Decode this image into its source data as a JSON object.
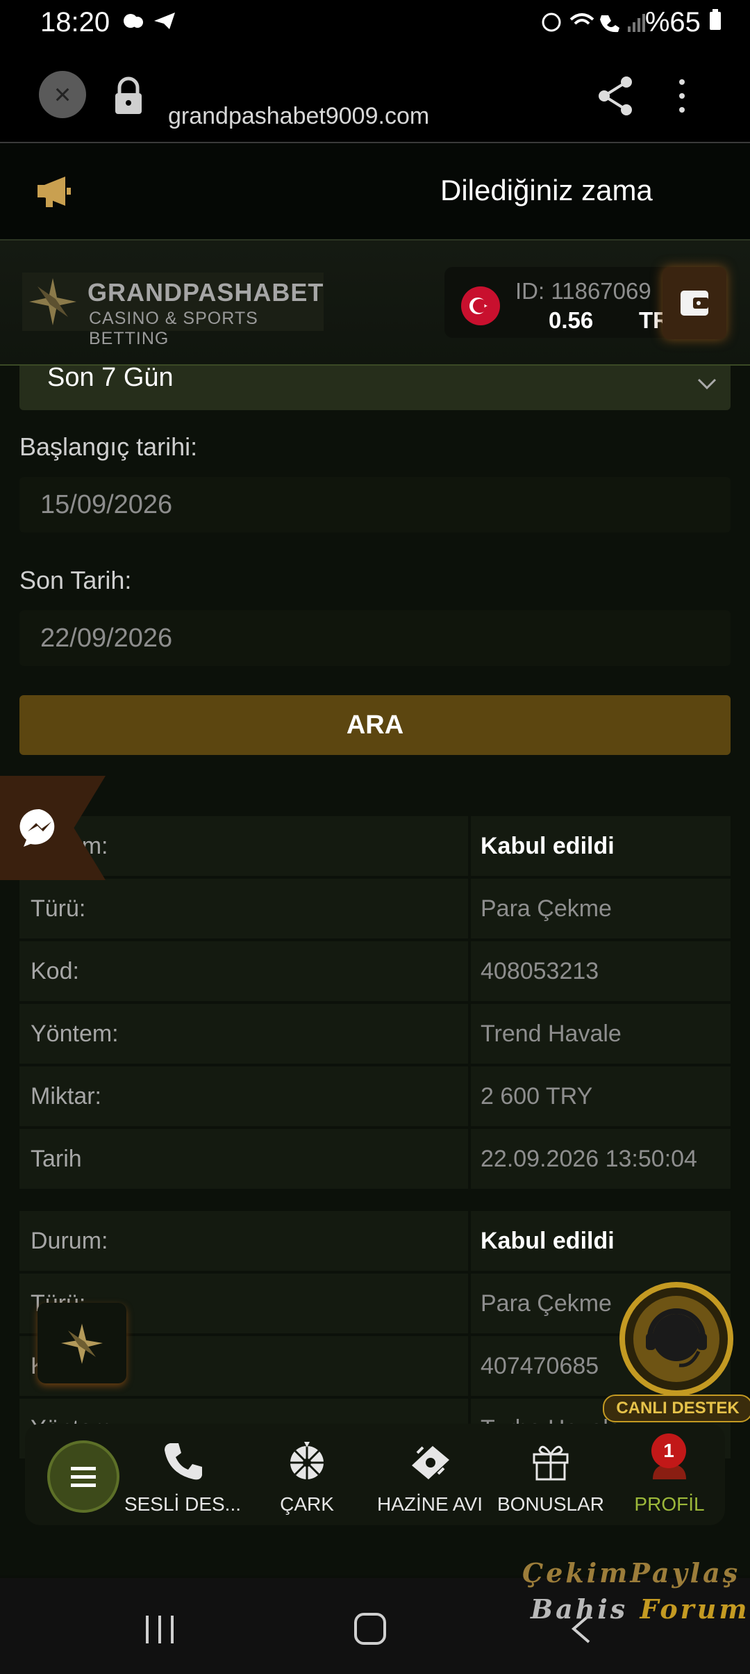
{
  "status_bar": {
    "time": "18:20",
    "battery": "%65",
    "left_icons": "weather telegram",
    "right_icons": "alarm wifi call signal"
  },
  "browser": {
    "url": "grandpashabet9009.com"
  },
  "announcement": {
    "text": "Dilediğiniz zama"
  },
  "header": {
    "logo_title": "GRANDPASHABET",
    "logo_subtitle": "CASINO & SPORTS BETTING",
    "account_id": "ID: 11867069",
    "balance": "0.56",
    "currency": "TRY"
  },
  "filters": {
    "period": "Son 7 Gün",
    "start_label": "Başlangıç tarihi:",
    "start_value": "15/09/2026",
    "end_label": "Son Tarih:",
    "end_value": "22/09/2026",
    "search_button": "ARA"
  },
  "transactions": [
    {
      "rows": [
        {
          "label": "Durum:",
          "value": "Kabul edildi"
        },
        {
          "label": "Türü:",
          "value": "Para Çekme"
        },
        {
          "label": "Kod:",
          "value": "408053213"
        },
        {
          "label": "Yöntem:",
          "value": "Trend Havale"
        },
        {
          "label": "Miktar:",
          "value": "2 600 TRY"
        },
        {
          "label": "Tarih",
          "value": "22.09.2026 13:50:04"
        }
      ]
    },
    {
      "rows": [
        {
          "label": "Durum:",
          "value": "Kabul edildi"
        },
        {
          "label": "Türü:",
          "value": "Para Çekme"
        },
        {
          "label": "Kod:",
          "value": "407470685"
        },
        {
          "label": "Yöntem:",
          "value": "Turbo Havale"
        }
      ]
    }
  ],
  "support": {
    "label": "CANLI DESTEK"
  },
  "bottom_nav": {
    "items": [
      {
        "label": "SESLİ DES...",
        "icon": "phone-icon"
      },
      {
        "label": "ÇARK",
        "icon": "wheel-icon"
      },
      {
        "label": "HAZİNE AVI",
        "icon": "treasure-icon"
      },
      {
        "label": "BONUSLAR",
        "icon": "gift-icon"
      },
      {
        "label": "PROFİL",
        "icon": "profile-icon"
      }
    ],
    "profile_badge": "1"
  },
  "watermark": {
    "line1": "ÇekimPaylaş",
    "line2_a": "Bahis",
    "line2_b": "Forum"
  },
  "colors": {
    "accent_gold": "#5c4610",
    "profile_green": "#9cb83a",
    "badge_red": "#c21818"
  }
}
